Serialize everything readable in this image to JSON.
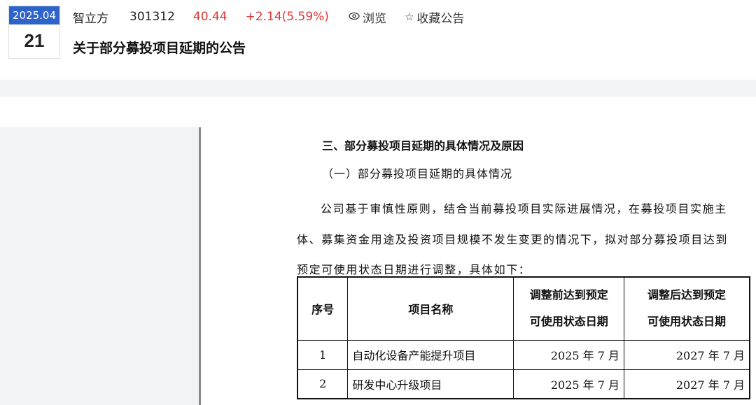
{
  "date": {
    "month": "2025.04",
    "day": "21"
  },
  "stock": {
    "name": "智立方",
    "code": "301312",
    "price": "40.44",
    "change": "+2.14(5.59%)"
  },
  "actions": {
    "browse_icon": "eye-icon",
    "browse": "浏览",
    "favorite_icon": "star-icon",
    "favorite": "收藏公告"
  },
  "title": "关于部分募投项目延期的公告",
  "document": {
    "section_heading": "三、部分募投项目延期的具体情况及原因",
    "sub_heading": "（一）部分募投项目延期的具体情况",
    "paragraph_lines": [
      "公司基于审慎性原则，结合当前募投项目实际进展情况，在募投项目实施主",
      "体、募集资金用途及投资项目规模不发生变更的情况下，拟对部分募投项目达到",
      "预定可使用状态日期进行调整，具体如下："
    ],
    "table": {
      "headers": {
        "seq": "序号",
        "name": "项目名称",
        "before_l1": "调整前达到预定",
        "before_l2": "可使用状态日期",
        "after_l1": "调整后达到预定",
        "after_l2": "可使用状态日期"
      },
      "rows": [
        {
          "seq": "1",
          "name": "自动化设备产能提升项目",
          "before": "2025 年 7 月",
          "after": "2027 年 7 月"
        },
        {
          "seq": "2",
          "name": "研发中心升级项目",
          "before": "2025 年 7 月",
          "after": "2027 年 7 月"
        }
      ]
    }
  },
  "colors": {
    "accent": "#2e63c9",
    "up": "#e03636",
    "panel": "#f2f3f5"
  }
}
